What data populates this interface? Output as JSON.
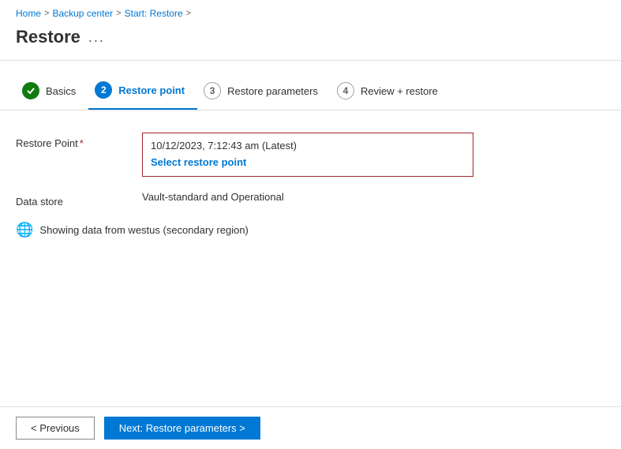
{
  "breadcrumb": {
    "items": [
      {
        "label": "Home",
        "href": "#"
      },
      {
        "label": "Backup center",
        "href": "#"
      },
      {
        "label": "Start: Restore",
        "href": "#"
      }
    ],
    "separators": [
      ">",
      ">",
      ">"
    ]
  },
  "page": {
    "title": "Restore",
    "menu_icon": "..."
  },
  "wizard": {
    "steps": [
      {
        "number": "✓",
        "label": "Basics",
        "state": "done"
      },
      {
        "number": "2",
        "label": "Restore point",
        "state": "current"
      },
      {
        "number": "3",
        "label": "Restore parameters",
        "state": "pending"
      },
      {
        "number": "4",
        "label": "Review + restore",
        "state": "pending"
      }
    ]
  },
  "form": {
    "restore_point_label": "Restore Point",
    "restore_point_required": "*",
    "restore_point_date": "10/12/2023, 7:12:43 am (Latest)",
    "select_restore_link": "Select restore point",
    "data_store_label": "Data store",
    "data_store_value": "Vault-standard and Operational",
    "info_text": "Showing data from westus (secondary region)"
  },
  "footer": {
    "previous_label": "< Previous",
    "next_label": "Next: Restore parameters >"
  }
}
